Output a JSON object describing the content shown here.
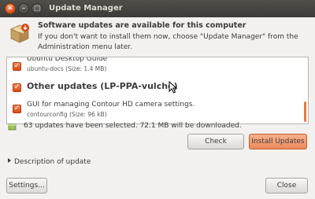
{
  "window": {
    "title": "Update Manager"
  },
  "header": {
    "title": "Software updates are available for this computer",
    "description": "If you don't want to install them now, choose \"Update Manager\" from the Administration menu later."
  },
  "update_list": {
    "items": [
      {
        "title": "Ubuntu Desktop Guide",
        "subtitle": "ubuntu-docs (Size: 1.4 MB)",
        "checked": true
      },
      {
        "group": "Other updates (LP-PPA-vulcho)",
        "checked": true
      },
      {
        "title": "GUI for managing Contour HD camera settings.",
        "subtitle": "contourconfig (Size: 96 kB)",
        "checked": true
      }
    ]
  },
  "status": {
    "text": "63 updates have been selected. 72.1 MB will be downloaded."
  },
  "buttons": {
    "check": "Check",
    "install": "Install Updates",
    "settings": "Settings...",
    "close": "Close"
  },
  "description_toggle": {
    "label": "Description of update"
  },
  "colors": {
    "accent": "#dd4814",
    "install_button": "#ec8a5c",
    "titlebar": "#3c3b37"
  }
}
